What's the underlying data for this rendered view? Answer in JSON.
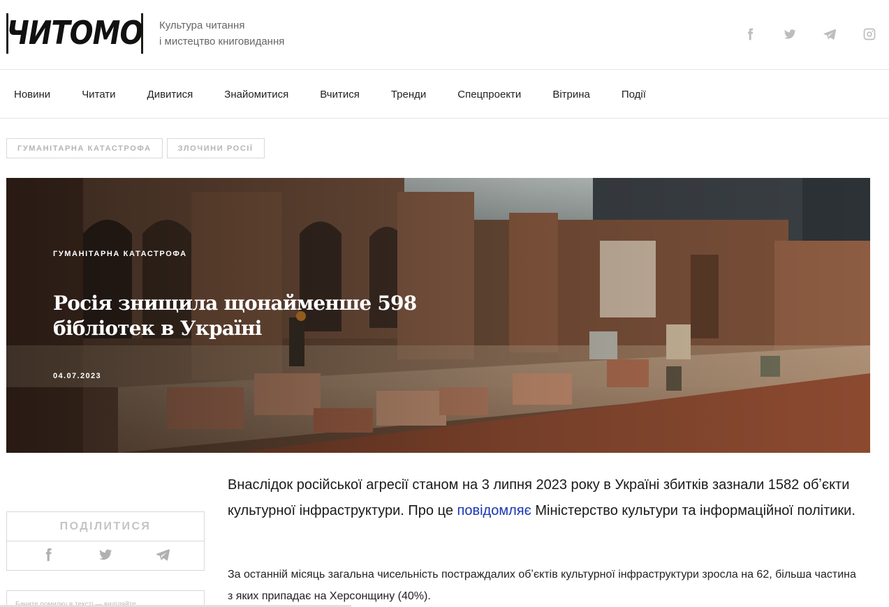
{
  "header": {
    "logo_text": "ЧИТОМО",
    "tagline_line1": "Культура читання",
    "tagline_line2": "і мистецтво книговидання",
    "social": [
      "facebook-icon",
      "twitter-icon",
      "telegram-icon",
      "instagram-icon"
    ]
  },
  "nav": {
    "items": [
      {
        "label": "Новини"
      },
      {
        "label": "Читати"
      },
      {
        "label": "Дивитися"
      },
      {
        "label": "Знайомитися"
      },
      {
        "label": "Вчитися"
      },
      {
        "label": "Тренди"
      },
      {
        "label": "Спецпроекти"
      },
      {
        "label": "Вітрина"
      },
      {
        "label": "Події"
      }
    ],
    "active": "Новини"
  },
  "tags": [
    {
      "label": "ГУМАНІТАРНА КАТАСТРОФА"
    },
    {
      "label": "ЗЛОЧИНИ РОСІЇ"
    }
  ],
  "hero": {
    "category": "ГУМАНІТАРНА КАТАСТРОФА",
    "title": "Росія знищила щонайменше 598 бібліотек в Україні",
    "date": "04.07.2023"
  },
  "share": {
    "title": "ПОДІЛИТИСЯ",
    "icons": [
      "facebook-icon",
      "twitter-icon",
      "telegram-icon"
    ],
    "typo_hint": "Бачите помилку в тексті — виділяйте"
  },
  "article": {
    "lead_part1": "Внаслідок російської агресії станом на 3 липня 2023 року в Україні збитків зазнали 1582 обʼєкти культурної інфраструктури. Про це ",
    "lead_link": "повідомляє",
    "lead_part2": " Міністерство культури та інформаційної політики.",
    "para1": "За останній місяць загальна чисельність постраждалих обʼєктів культурної інфраструктури зросла на 62, більша частина з яких припадає на Херсонщину (40%)."
  }
}
